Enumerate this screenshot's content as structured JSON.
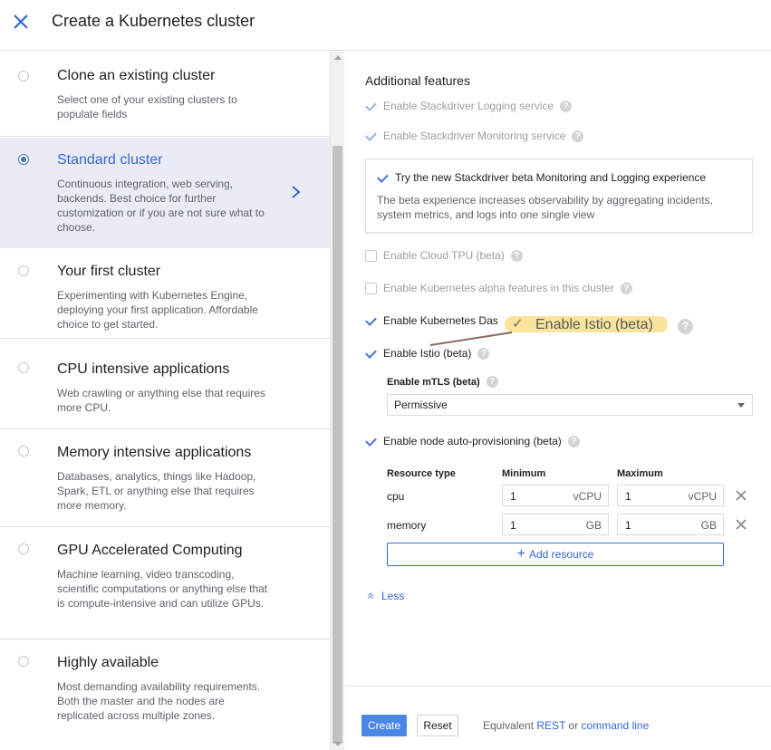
{
  "header": {
    "title": "Create a Kubernetes cluster",
    "close_icon": "close-icon"
  },
  "templates": [
    {
      "name": "Clone an existing cluster",
      "desc": "Select one of your existing clusters to populate fields",
      "selected": false
    },
    {
      "name": "Standard cluster",
      "desc": "Continuous integration, web serving, backends. Best choice for further customization or if you are not sure what to choose.",
      "selected": true
    },
    {
      "name": "Your first cluster",
      "desc": "Experimenting with Kubernetes Engine, deploying your first application. Affordable choice to get started.",
      "selected": false
    },
    {
      "name": "CPU intensive applications",
      "desc": "Web crawling or anything else that requires more CPU.",
      "selected": false
    },
    {
      "name": "Memory intensive applications",
      "desc": "Databases, analytics, things like Hadoop, Spark, ETL or anything else that requires more memory.",
      "selected": false
    },
    {
      "name": "GPU Accelerated Computing",
      "desc": "Machine learning, video transcoding, scientific computations or anything else that is compute-intensive and can utilize GPUs.",
      "selected": false
    },
    {
      "name": "Highly available",
      "desc": "Most demanding availability requirements. Both the master and the nodes are replicated across multiple zones.",
      "selected": false
    }
  ],
  "features": {
    "title": "Additional features",
    "logging": "Enable Stackdriver Logging service",
    "monitoring": "Enable Stackdriver Monitoring service",
    "beta_experience": "Try the new Stackdriver beta Monitoring and Logging experience",
    "beta_desc": "The beta experience increases observability by aggregating incidents, system metrics, and logs into one single view",
    "cloud_tpu": "Enable Cloud TPU (beta)",
    "alpha": "Enable Kubernetes alpha features in this cluster",
    "dashboard": "Enable Kubernetes Das",
    "istio": "Enable Istio (beta)",
    "annotation": "Enable Istio (beta)",
    "help_glyph": "?",
    "mtls_label": "Enable mTLS (beta)",
    "mtls_value": "Permissive",
    "autoprov": "Enable node auto-provisioning (beta)"
  },
  "resources": {
    "headers": {
      "type": "Resource type",
      "min": "Minimum",
      "max": "Maximum"
    },
    "rows": [
      {
        "name": "cpu",
        "min": "1",
        "max": "1",
        "unit": "vCPU"
      },
      {
        "name": "memory",
        "min": "1",
        "max": "1",
        "unit": "GB"
      }
    ],
    "add_label": "Add resource",
    "add_glyph": "+"
  },
  "less_label": "Less",
  "footer": {
    "create": "Create",
    "reset": "Reset",
    "equivalent": "Equivalent",
    "rest": "REST",
    "or": "or",
    "command_line": "command line"
  },
  "colors": {
    "accent": "#3367d6",
    "create_button": "#4a86e8",
    "highlight": "#f7e08a",
    "selected_bg": "#e9ecf7"
  }
}
